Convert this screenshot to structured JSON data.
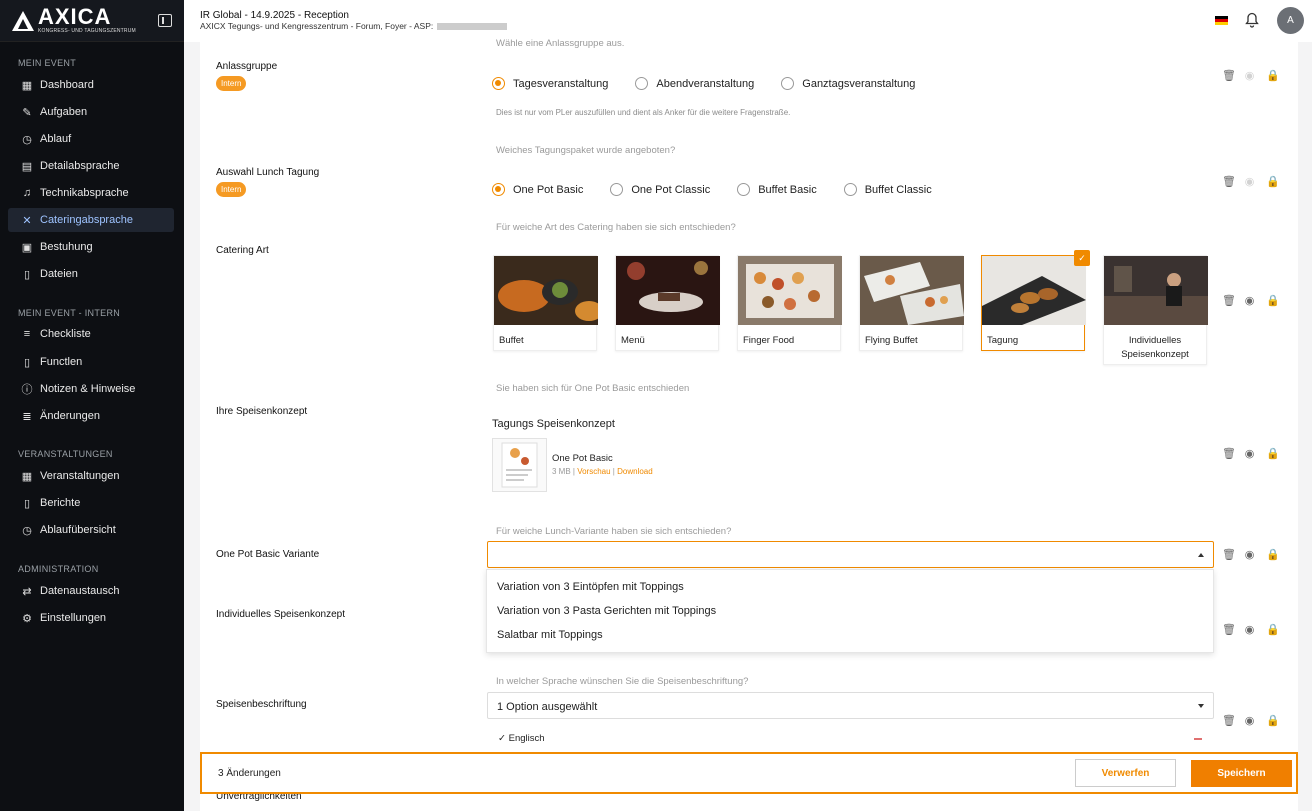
{
  "brand": {
    "title": "AXICA",
    "subtitle": "KONGRESS- UND TAGUNGSZENTRUM"
  },
  "header": {
    "title": "IR Global - 14.9.2025 - Reception",
    "subtitle": "AXICX Tegungs- und Kengresszentrum - Forum, Foyer - ASP:",
    "avatar": "A"
  },
  "sidebar": {
    "section1": "MEIN EVENT",
    "items1": [
      {
        "label": "Dashboard",
        "icon": "grid-icon"
      },
      {
        "label": "Aufgaben",
        "icon": "edit-icon"
      },
      {
        "label": "Ablauf",
        "icon": "clock-icon"
      },
      {
        "label": "Detailabsprache",
        "icon": "clipboard-icon"
      },
      {
        "label": "Technikabsprache",
        "icon": "mic-icon"
      },
      {
        "label": "Cateringabsprache",
        "icon": "cutlery-icon"
      },
      {
        "label": "Bestuhung",
        "icon": "seating-icon"
      },
      {
        "label": "Dateien",
        "icon": "file-icon"
      }
    ],
    "section2": "MEIN EVENT - INTERN",
    "items2": [
      {
        "label": "Checkliste",
        "icon": "checklist-icon"
      },
      {
        "label": "Functlen",
        "icon": "document-icon"
      },
      {
        "label": "Notizen & Hinweise",
        "icon": "info-icon"
      },
      {
        "label": "Änderungen",
        "icon": "list-icon"
      }
    ],
    "section3": "VERANSTALTUNGEN",
    "items3": [
      {
        "label": "Veranstaltungen",
        "icon": "calendar-icon"
      },
      {
        "label": "Berichte",
        "icon": "report-icon"
      },
      {
        "label": "Ablaufübersicht",
        "icon": "clock-icon"
      }
    ],
    "section4": "ADMINISTRATION",
    "items4": [
      {
        "label": "Datenaustausch",
        "icon": "swap-icon"
      },
      {
        "label": "Einstellungen",
        "icon": "gear-icon"
      }
    ]
  },
  "form": {
    "top_hint": "Wähle eine Anlassgruppe aus.",
    "anlass": {
      "label": "Anlassgruppe",
      "badge": "Intern",
      "options": [
        "Tagesveranstaltung",
        "Abendveranstaltung",
        "Ganztagsveranstaltung"
      ],
      "selected": "Tagesveranstaltung",
      "note": "Dies ist nur vom PLer auszufüllen und dient als Anker für die weitere Fragenstraße."
    },
    "lunch": {
      "question": "Weiches Tagungspaket wurde angeboten?",
      "label": "Auswahl Lunch Tagung",
      "badge": "Intern",
      "options": [
        "One Pot Basic",
        "One Pot Classic",
        "Buffet Basic",
        "Buffet Classic"
      ],
      "selected": "One Pot Basic"
    },
    "catering": {
      "question": "Für weiche Art des Catering haben sie sich entschieden?",
      "label": "Catering Art",
      "cards": [
        "Buffet",
        "Menü",
        "Finger Food",
        "Flying Buffet",
        "Tagung",
        "Individuelles Speisenkonzept"
      ],
      "selected": "Tagung"
    },
    "konzept": {
      "question": "Sie haben sich für One Pot Basic entschieden",
      "label": "Ihre Speisenkonzept",
      "title": "Tagungs Speisenkonzept",
      "file_name": "One Pot Basic",
      "file_size": "3 MB",
      "preview": "Vorschau",
      "download": "Download"
    },
    "variante": {
      "question": "Für weiche Lunch-Variante haben sie sich entschieden?",
      "label": "One Pot Basic Variante",
      "value": "",
      "options": [
        "Variation von 3 Eintöpfen mit Toppings",
        "Variation von 3 Pasta Gerichten mit Toppings",
        "Salatbar mit Toppings"
      ]
    },
    "individuell": {
      "label": "Individuelles Speisenkonzept"
    },
    "beschriftung": {
      "question": "In welcher Sprache wünschen Sie die Speisenbeschriftung?",
      "label": "Speisenbeschriftung",
      "value": "1 Option ausgewählt",
      "chip": "Englisch"
    },
    "partial_label": "Unvertraglichkeiten"
  },
  "footer": {
    "changes": "3 Änderungen",
    "discard": "Verwerfen",
    "save": "Speichern"
  },
  "colors": {
    "accent": "#f08a00",
    "sidebar": "#0d0f13"
  }
}
